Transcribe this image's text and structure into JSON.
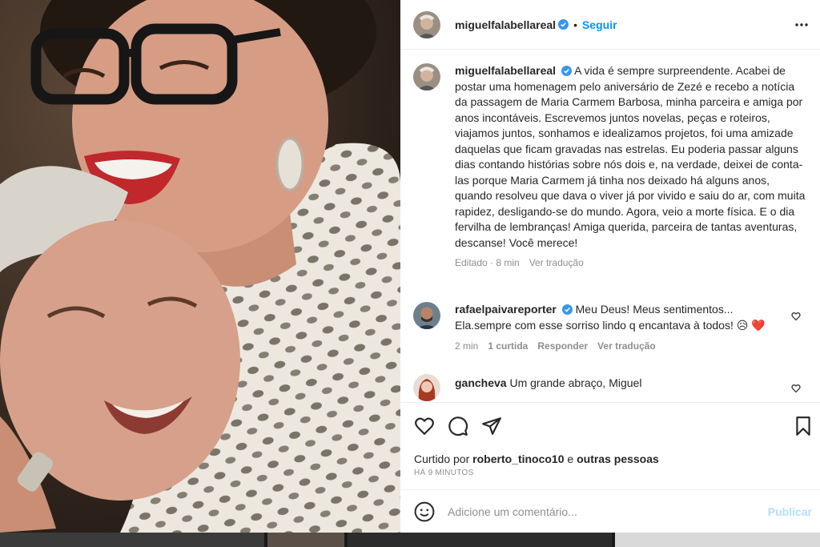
{
  "post": {
    "username": "miguelfalabellareal",
    "separator": "•",
    "follow_label": "Seguir",
    "caption": "A vida é sempre surpreendente. Acabei de postar uma homenagem pelo aniversário de Zezé e recebo a notícia da passagem de Maria Carmem Barbosa, minha parceira e amiga por anos incontáveis. Escrevemos juntos novelas, peças e roteiros, viajamos juntos, sonhamos e idealizamos projetos, foi uma amizade daquelas que ficam gravadas nas estrelas. Eu poderia passar alguns dias contando histórias sobre nós dois e, na verdade, deixei de conta-las porque Maria Carmem já tinha nos deixado há alguns anos, quando resolveu que dava o viver já por vivido e saiu do ar, com muita rapidez, desligando-se do mundo. Agora, veio a morte física. E o dia fervilha de lembranças! Amiga querida, parceira de tantas aventuras, descanse! Você merece!",
    "caption_meta": {
      "edited": "Editado · 8 min",
      "translate": "Ver tradução"
    }
  },
  "comments": [
    {
      "username": "rafaelpaivareporter",
      "text_line1": "Meu Deus! Meus sentimentos...",
      "text_line2": "Ela.sempre com esse sorriso lindo q encantava à todos! 😥 ❤️",
      "time": "2 min",
      "likes": "1 curtida",
      "reply": "Responder",
      "translate": "Ver tradução"
    },
    {
      "username": "gancheva",
      "text": "Um grande abraço, Miguel"
    }
  ],
  "likes": {
    "prefix": "Curtido por",
    "user": "roberto_tinoco10",
    "conj": "e",
    "others": "outras pessoas"
  },
  "timestamp": "HÁ 9 MINUTOS",
  "composer": {
    "placeholder": "Adicione um comentário...",
    "publish_label": "Publicar"
  },
  "icons": {
    "more": "more-options-icon",
    "like": "heart-icon",
    "comment": "comment-icon",
    "share": "share-icon",
    "save": "bookmark-icon",
    "emoji": "emoji-icon",
    "verified": "verified-badge-icon"
  },
  "colors": {
    "accent": "#0095f6",
    "verified": "#3897f0",
    "muted": "#8e8e8e",
    "publish_disabled": "#b2dffc"
  }
}
